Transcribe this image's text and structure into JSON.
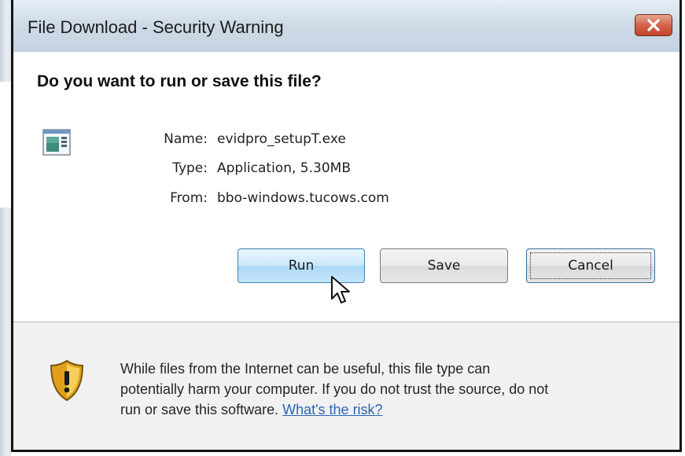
{
  "window": {
    "title": "File Download - Security Warning",
    "close_icon": "close-icon"
  },
  "prompt": {
    "heading": "Do you want to run or save this file?"
  },
  "file": {
    "icon": "application-icon",
    "name_label": "Name:",
    "name_value": "evidpro_setupT.exe",
    "type_label": "Type:",
    "type_value": "Application, 5.30MB",
    "from_label": "From:",
    "from_value": "bbo-windows.tucows.com"
  },
  "buttons": {
    "run": "Run",
    "save": "Save",
    "cancel": "Cancel"
  },
  "warning": {
    "icon": "shield-warning-icon",
    "line1": "While files from the Internet can be useful, this file type can",
    "line2": "potentially harm your computer. If you do not trust the source, do not",
    "line3": "run or save this software. ",
    "link": "What's the risk?"
  },
  "colors": {
    "link": "#2a64b8",
    "close_button": "#c4432a",
    "run_button": "#acd8f4"
  }
}
